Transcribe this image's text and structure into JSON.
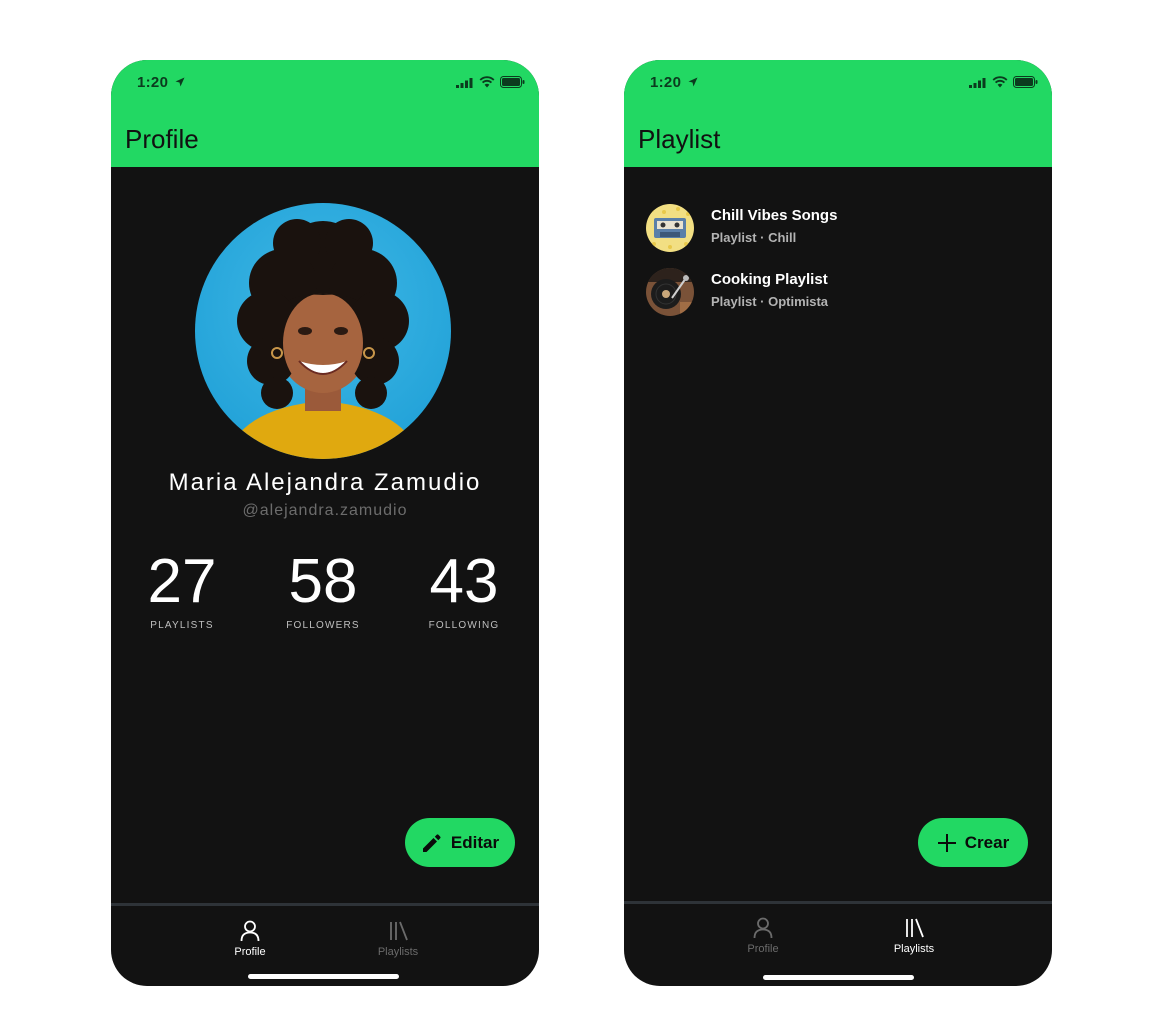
{
  "status_bar": {
    "time": "1:20"
  },
  "profile_screen": {
    "title": "Profile",
    "user": {
      "name": "Maria Alejandra Zamudio",
      "handle": "@alejandra.zamudio"
    },
    "stats": [
      {
        "value": "27",
        "label": "PLAYLISTS"
      },
      {
        "value": "58",
        "label": "FOLLOWERS"
      },
      {
        "value": "43",
        "label": "FOLLOWING"
      }
    ],
    "fab_label": "Editar",
    "tabs": [
      {
        "label": "Profile",
        "icon": "person-icon",
        "active": true
      },
      {
        "label": "Playlists",
        "icon": "library-icon",
        "active": false
      }
    ]
  },
  "playlist_screen": {
    "title": "Playlist",
    "items": [
      {
        "title": "Chill Vibes Songs",
        "subtitle": "Playlist · Chill",
        "thumb": "cassette-thumbnail"
      },
      {
        "title": "Cooking Playlist",
        "subtitle": "Playlist · Optimista",
        "thumb": "record-player-thumbnail"
      }
    ],
    "fab_label": "Crear",
    "tabs": [
      {
        "label": "Profile",
        "icon": "person-icon",
        "active": false
      },
      {
        "label": "Playlists",
        "icon": "library-icon",
        "active": true
      }
    ]
  },
  "colors": {
    "accent": "#22d863",
    "background": "#121212",
    "divider": "#2e3338"
  }
}
